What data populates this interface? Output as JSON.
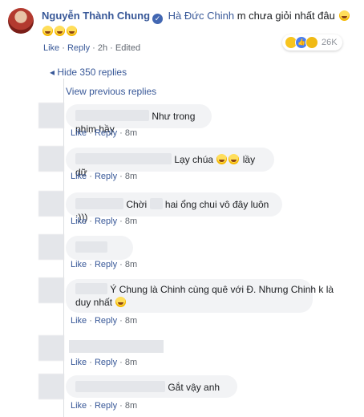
{
  "post": {
    "author": "Nguyễn Thành Chung",
    "mention": "Hà Đức Chinh",
    "text": "m chưa giỏi nhất đâu",
    "actions": {
      "like": "Like",
      "reply": "Reply",
      "time": "2h",
      "edited": "Edited"
    },
    "reactions_count": "26K"
  },
  "thread": {
    "hide_replies": "Hide 350 replies",
    "view_previous": "View previous replies"
  },
  "replies": [
    {
      "text": "Như trong phim hầy",
      "like": "Like",
      "reply": "Reply",
      "time": "8m"
    },
    {
      "text": "Lạy chúa",
      "text_after": "lầy dữ",
      "like": "Like",
      "reply": "Reply",
      "time": "8m"
    },
    {
      "text": "Chời",
      "text_after": "hai ổng chui vô đây luôn :)))",
      "like": "Like",
      "reply": "Reply",
      "time": "8m"
    },
    {
      "text": "",
      "like": "Like",
      "reply": "Reply",
      "time": "8m"
    },
    {
      "text": "Ý Chung là Chinh cùng quê với Đ. Nhưng Chinh k là",
      "text_line2": "duy nhất",
      "like": "Like",
      "reply": "Reply",
      "time": "8m"
    },
    {
      "text": "",
      "like": "Like",
      "reply": "Reply",
      "time": "8m"
    },
    {
      "text": "Gắt vậy anh",
      "like": "Like",
      "reply": "Reply",
      "time": "8m"
    }
  ],
  "colors": {
    "link": "#385898",
    "bubble": "#f2f3f5",
    "meta": "#616770"
  }
}
